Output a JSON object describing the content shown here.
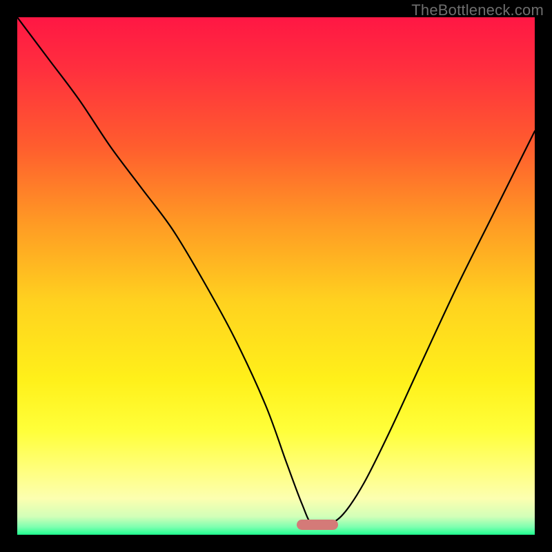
{
  "watermark": "TheBottleneck.com",
  "chart_data": {
    "type": "line",
    "title": "",
    "xlabel": "",
    "ylabel": "",
    "xlim": [
      0,
      100
    ],
    "ylim": [
      0,
      100
    ],
    "grid": false,
    "legend": null,
    "gradient_stops": [
      {
        "offset": 0,
        "color": "#ff1744"
      },
      {
        "offset": 0.1,
        "color": "#ff2f3e"
      },
      {
        "offset": 0.25,
        "color": "#ff5d2e"
      },
      {
        "offset": 0.4,
        "color": "#ff9b24"
      },
      {
        "offset": 0.55,
        "color": "#ffd21f"
      },
      {
        "offset": 0.7,
        "color": "#fff01a"
      },
      {
        "offset": 0.8,
        "color": "#ffff3a"
      },
      {
        "offset": 0.88,
        "color": "#ffff82"
      },
      {
        "offset": 0.93,
        "color": "#fcffb0"
      },
      {
        "offset": 0.965,
        "color": "#d2ffb8"
      },
      {
        "offset": 0.985,
        "color": "#7effb0"
      },
      {
        "offset": 1.0,
        "color": "#1eff8f"
      }
    ],
    "series": [
      {
        "name": "bottleneck-curve",
        "x": [
          0,
          6,
          12,
          18,
          24,
          30,
          36,
          42,
          48,
          52,
          55,
          57,
          60,
          63,
          67,
          72,
          78,
          85,
          92,
          100
        ],
        "values": [
          100,
          92,
          84,
          75,
          67,
          59,
          49,
          38,
          25,
          14,
          6,
          2,
          2,
          4,
          10,
          20,
          33,
          48,
          62,
          78
        ]
      }
    ],
    "marker": {
      "name": "optimal-zone",
      "x_center": 58,
      "y": 2,
      "width_pct": 8,
      "height_pct": 2,
      "color": "#d47a78"
    }
  }
}
